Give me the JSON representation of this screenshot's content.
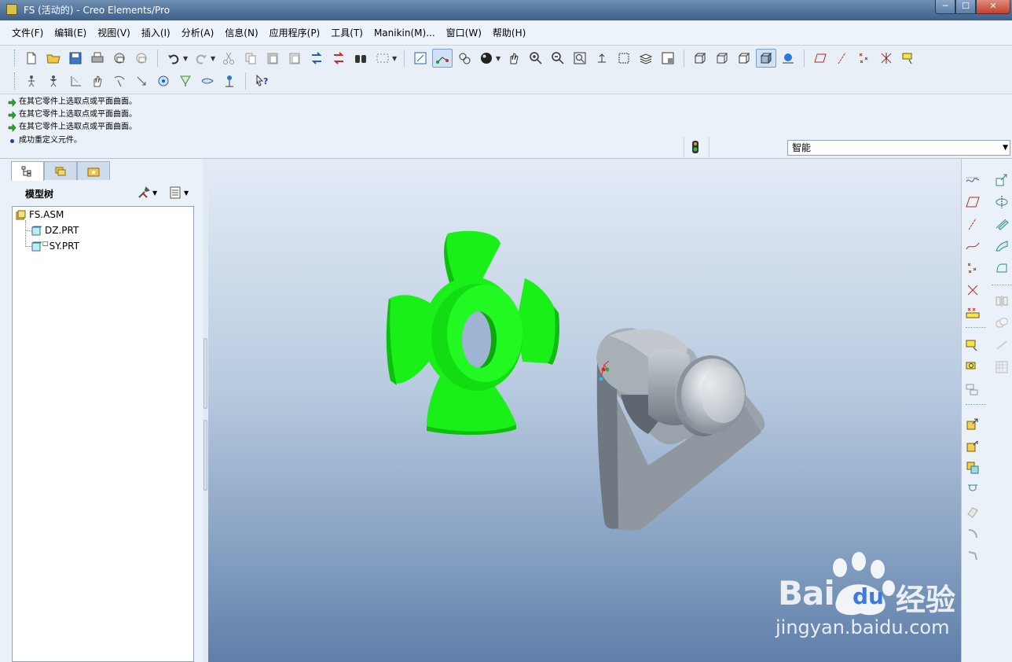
{
  "window": {
    "title": "FS (活动的) - Creo Elements/Pro",
    "min_glyph": "─",
    "max_glyph": "☐",
    "close_glyph": "✕"
  },
  "menu": [
    "文件(F)",
    "编辑(E)",
    "视图(V)",
    "插入(I)",
    "分析(A)",
    "信息(N)",
    "应用程序(P)",
    "工具(T)",
    "Manikin(M)...",
    "窗口(W)",
    "帮助(H)"
  ],
  "messages": [
    {
      "type": "prompt",
      "text": "在其它零件上选取点或平面曲面。"
    },
    {
      "type": "prompt",
      "text": "在其它零件上选取点或平面曲面。"
    },
    {
      "type": "prompt",
      "text": "在其它零件上选取点或平面曲面。"
    },
    {
      "type": "info",
      "text": "成功重定义元件。"
    }
  ],
  "filter": {
    "value": "智能"
  },
  "model_tree": {
    "title": "模型树",
    "items": [
      {
        "label": "FS.ASM",
        "type": "assembly"
      },
      {
        "label": "DZ.PRT",
        "type": "part"
      },
      {
        "label": "SY.PRT",
        "type": "part",
        "marker": "□"
      }
    ]
  },
  "watermark": {
    "brand_bai": "Bai",
    "brand_du": "du",
    "brand_cn": "经验",
    "url": "jingyan.baidu.com"
  },
  "colors": {
    "fan": "#1aff1a",
    "base_part": "#9aa3ab",
    "viewport_top": "#e4ecf6",
    "viewport_bottom": "#5f7fa9"
  }
}
